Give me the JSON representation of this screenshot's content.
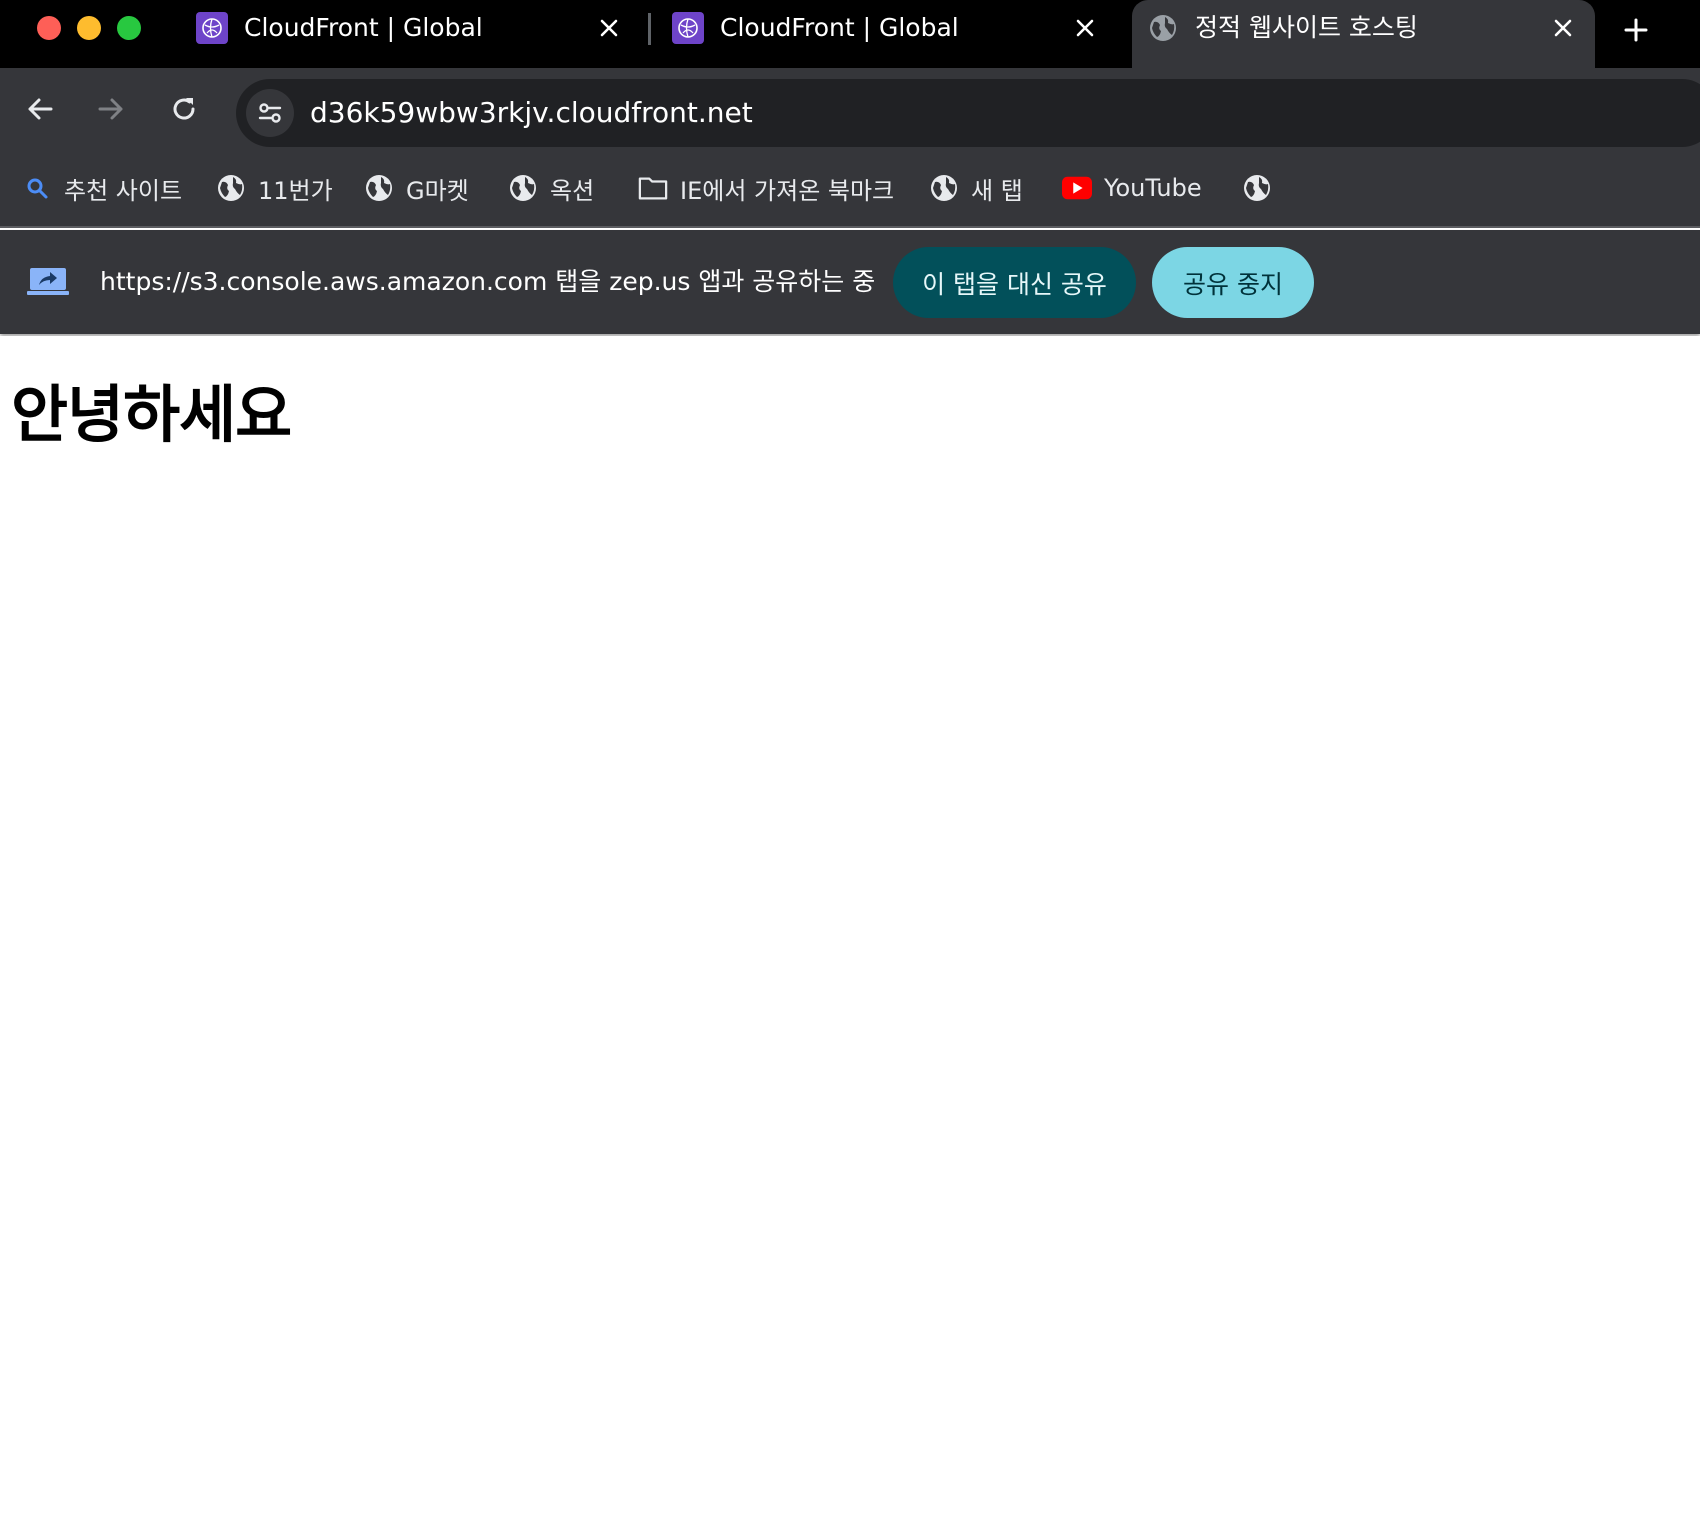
{
  "tabs": [
    {
      "title": "CloudFront | Global",
      "icon": "cloudfront-icon"
    },
    {
      "title": "CloudFront | Global",
      "icon": "cloudfront-icon"
    },
    {
      "title": "정적 웹사이트 호스팅",
      "icon": "globe-icon",
      "active": true
    }
  ],
  "toolbar": {
    "url": "d36k59wbw3rkjv.cloudfront.net"
  },
  "bookmarks": [
    {
      "label": "추천 사이트",
      "icon": "search-icon"
    },
    {
      "label": "11번가",
      "icon": "globe-icon"
    },
    {
      "label": "G마켓",
      "icon": "globe-icon"
    },
    {
      "label": "옥션",
      "icon": "globe-icon"
    },
    {
      "label": "IE에서 가져온 북마크",
      "icon": "folder-icon"
    },
    {
      "label": "새 탭",
      "icon": "globe-icon"
    },
    {
      "label": "YouTube",
      "icon": "youtube-icon"
    },
    {
      "label": "",
      "icon": "globe-icon"
    }
  ],
  "sharing": {
    "message": "https://s3.console.aws.amazon.com 탭을 zep.us 앱과 공유하는 중",
    "share_this_tab": "이 탭을 대신 공유",
    "stop_sharing": "공유 중지"
  },
  "page": {
    "heading": "안녕하세요"
  },
  "colors": {
    "tabstrip": "#000000",
    "toolbar": "#35363a",
    "omnibox": "#202124",
    "share_button": "#02505a",
    "stop_button": "#7cd6e4",
    "cloudfront_icon": "#6e44c9",
    "youtube_red": "#ff0000"
  }
}
